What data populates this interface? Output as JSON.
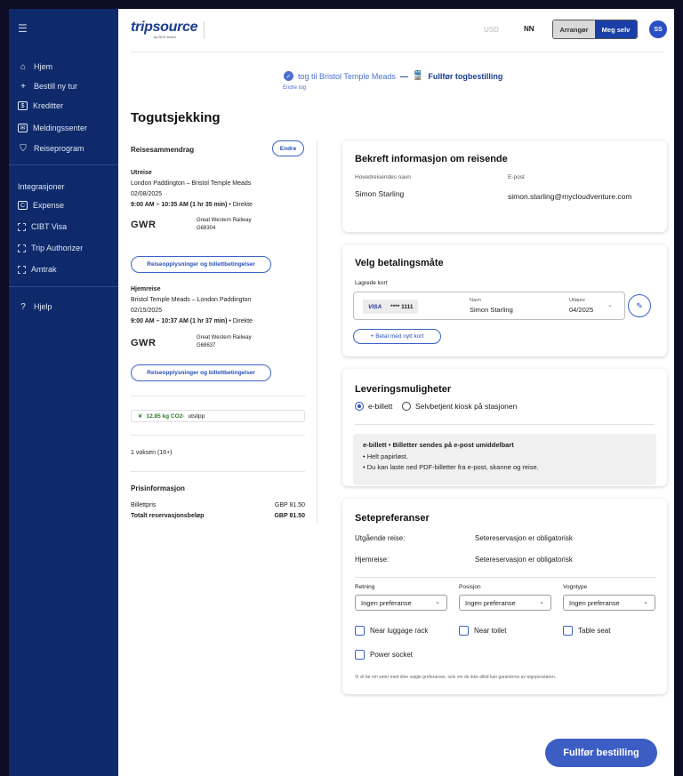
{
  "sidebar": {
    "items": [
      {
        "label": "Hjem",
        "icon": "home-icon"
      },
      {
        "label": "Bestill ny tur",
        "icon": "plus-icon"
      },
      {
        "label": "Kreditter",
        "icon": "credit-icon"
      },
      {
        "label": "Meldingssenter",
        "icon": "mail-icon"
      },
      {
        "label": "Reiseprogram",
        "icon": "shield-icon"
      }
    ],
    "integrations_heading": "Integrasjoner",
    "integrations": [
      {
        "label": "Expense",
        "icon": "expense-icon"
      },
      {
        "label": "CIBT Visa",
        "icon": "integration-icon"
      },
      {
        "label": "Trip Authorizer",
        "icon": "integration-icon"
      },
      {
        "label": "Amtrak",
        "icon": "integration-icon"
      }
    ],
    "help": "Hjelp"
  },
  "header": {
    "logo": "tripsource",
    "logo_sub": "by BCD travel",
    "currency": "USD",
    "language": "NN",
    "toggle": {
      "left": "Arrangør",
      "right": "Meg selv",
      "active": "right"
    },
    "avatar": "SS"
  },
  "breadcrumb": {
    "done": "tog til Bristol Temple Meads",
    "separator": "—",
    "current": "Fullfør togbestilling",
    "edit": "Endre tog"
  },
  "page_title": "Togutsjekking",
  "summary": {
    "title": "Reisesammendrag",
    "edit": "Endre",
    "outbound": {
      "heading": "Utreise",
      "route": "London Paddington – Bristol Temple Meads",
      "date": "02/08/2025",
      "time": "9:00 AM – 10:35 AM",
      "duration": "(1 hr 35 min)",
      "type": " • Direkte",
      "operator_logo": "GWR",
      "operator": "Great Western Railway",
      "code": "G68304",
      "info_button": "Reiseopplysninger og billettbetingelser"
    },
    "return": {
      "heading": "Hjemreise",
      "route": "Bristol Temple Meads – London Paddington",
      "date": "02/15/2025",
      "time": "9:00 AM – 10:37 AM",
      "duration": "(1 hr 37 min)",
      "type": " • Direkte",
      "operator_logo": "GWR",
      "operator": "Great Western Railway",
      "code": "G68637",
      "info_button": "Reiseopplysninger og billettbetingelser"
    },
    "co2_value": "12.85 kg CO2-",
    "co2_label": "utslipp",
    "travellers": "1 voksen (16+)",
    "price_heading": "Prisinformasjon",
    "fare_label": "Billettpris",
    "fare_value": "GBP  81.50",
    "total_label": "Totalt reservasjonsbeløp",
    "total_value": "GBP  81.50"
  },
  "traveller_card": {
    "title": "Bekreft informasjon om reisende",
    "name_label": "Hovedreisendes navn",
    "name": "Simon Starling",
    "email_label": "E-post",
    "email": "simon.starling@mycloudventure.com"
  },
  "payment_card": {
    "title": "Velg betalingsmåte",
    "saved_label": "Lagrede kort",
    "card_brand": "VISA",
    "card_masked": "**** 1111",
    "name_label": "Navn",
    "name": "Simon Starling",
    "expiry_label": "Utløper",
    "expiry": "04/2025",
    "add_card": "+ Betal med nytt kort"
  },
  "delivery_card": {
    "title": "Leveringsmuligheter",
    "options": [
      "e-billett",
      "Selvbetjent kiosk på stasjonen"
    ],
    "selected": 0,
    "info_title": "e-billett • Billetter sendes på e-post umiddelbart",
    "info_lines": [
      "• Helt papirløst.",
      "• Du kan laste ned PDF-billetter fra e-post, skanne og reise."
    ]
  },
  "seat_card": {
    "title": "Setepreferanser",
    "outbound_label": "Utgående reise:",
    "outbound_value": "Setereservasjon er obligatorisk",
    "return_label": "Hjemreise:",
    "return_value": "Setereservasjon er obligatorisk",
    "selects": [
      {
        "label": "Retning",
        "value": "Ingen preferanse"
      },
      {
        "label": "Posisjon",
        "value": "Ingen preferanse"
      },
      {
        "label": "Vogntype",
        "value": "Ingen preferanse"
      }
    ],
    "checkboxes": [
      "Near luggage rack",
      "Near toilet",
      "Table seat",
      "Power socket"
    ],
    "note": "Vi vil be om seter med dine valgte preferanser, selv om de ikke alltid kan garanteres av togoperatøren."
  },
  "cta": "Fullfør bestilling",
  "colors": {
    "sidebar": "#0e2a6b",
    "accent": "#3c5ec4",
    "co2": "#2e7a2e"
  }
}
